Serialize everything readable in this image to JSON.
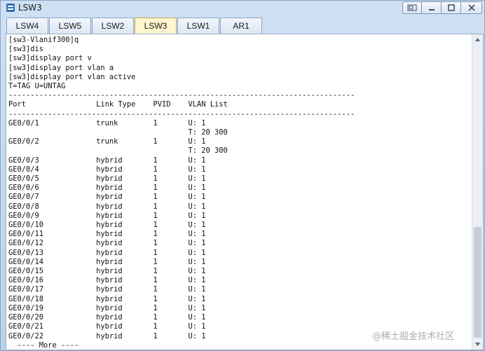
{
  "window": {
    "title": "LSW3"
  },
  "tabs": [
    {
      "label": "LSW4"
    },
    {
      "label": "LSW5"
    },
    {
      "label": "LSW2"
    },
    {
      "label": "LSW3",
      "active": true
    },
    {
      "label": "LSW1"
    },
    {
      "label": "AR1"
    }
  ],
  "terminal": {
    "lines": [
      "[sw3-Vlanif300]q",
      "[sw3]dis",
      "[sw3]display port v",
      "[sw3]display port vlan a",
      "[sw3]display port vlan active",
      "T=TAG U=UNTAG",
      "-------------------------------------------------------------------------------",
      "Port                Link Type    PVID    VLAN List",
      "-------------------------------------------------------------------------------",
      "GE0/0/1             trunk        1       U: 1",
      "                                         T: 20 300",
      "GE0/0/2             trunk        1       U: 1",
      "                                         T: 20 300",
      "GE0/0/3             hybrid       1       U: 1",
      "GE0/0/4             hybrid       1       U: 1",
      "GE0/0/5             hybrid       1       U: 1",
      "GE0/0/6             hybrid       1       U: 1",
      "GE0/0/7             hybrid       1       U: 1",
      "GE0/0/8             hybrid       1       U: 1",
      "GE0/0/9             hybrid       1       U: 1",
      "GE0/0/10            hybrid       1       U: 1",
      "GE0/0/11            hybrid       1       U: 1",
      "GE0/0/12            hybrid       1       U: 1",
      "GE0/0/13            hybrid       1       U: 1",
      "GE0/0/14            hybrid       1       U: 1",
      "GE0/0/15            hybrid       1       U: 1",
      "GE0/0/16            hybrid       1       U: 1",
      "GE0/0/17            hybrid       1       U: 1",
      "GE0/0/18            hybrid       1       U: 1",
      "GE0/0/19            hybrid       1       U: 1",
      "GE0/0/20            hybrid       1       U: 1",
      "GE0/0/21            hybrid       1       U: 1",
      "GE0/0/22            hybrid       1       U: 1",
      "  ---- More ----"
    ]
  },
  "watermark": "@稀土掘金技术社区",
  "icons": {
    "app": "switch-icon",
    "restore": "restore-icon",
    "minimize": "minimize-icon",
    "maximize": "maximize-icon",
    "close": "close-icon"
  }
}
